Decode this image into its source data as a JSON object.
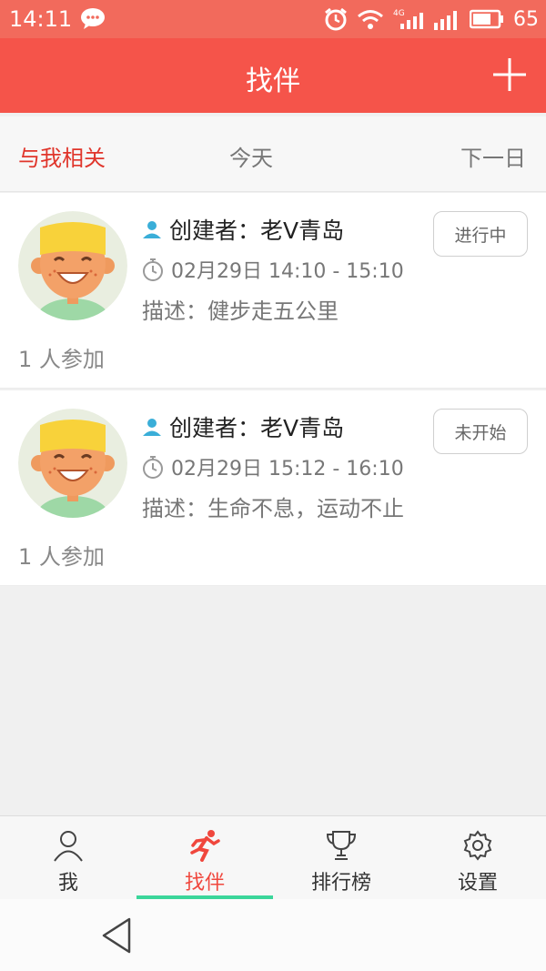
{
  "status_bar": {
    "time": "14:11",
    "battery": "65",
    "network": "4G"
  },
  "app_bar": {
    "title": "找伴",
    "add_icon": "plus-icon"
  },
  "filter": {
    "related": "与我相关",
    "today": "今天",
    "next_day": "下一日"
  },
  "activities": [
    {
      "creator": "创建者：老V青岛",
      "time": "02月29日  14:10 - 15:10",
      "description": "描述：健步走五公里",
      "participants": "1 人参加",
      "status": "进行中"
    },
    {
      "creator": "创建者：老V青岛",
      "time": "02月29日  15:12 - 16:10",
      "description": "描述：生命不息，运动不止",
      "participants": "1 人参加",
      "status": "未开始"
    }
  ],
  "tabs": [
    {
      "label": "我",
      "icon": "person-icon"
    },
    {
      "label": "找伴",
      "icon": "runner-icon",
      "active": true
    },
    {
      "label": "排行榜",
      "icon": "trophy-icon"
    },
    {
      "label": "设置",
      "icon": "gear-icon"
    }
  ],
  "colors": {
    "accent": "#f5544a",
    "status_bar": "#f26a5c",
    "active_tab_underline": "#3bd69a",
    "active_text": "#e0352b"
  }
}
